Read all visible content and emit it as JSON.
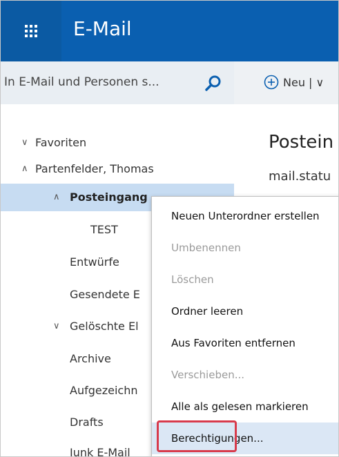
{
  "app": {
    "title": "E-Mail"
  },
  "search": {
    "placeholder": "In E-Mail und Personen s..."
  },
  "command_bar": {
    "new_label": "Neu | ∨"
  },
  "tree": [
    {
      "label": "Favoriten",
      "chevron": "∨"
    },
    {
      "label": "Partenfelder, Thomas",
      "chevron": "∧"
    },
    {
      "label": "Posteingang",
      "chevron": "∧",
      "selected": true
    },
    {
      "label": "TEST"
    },
    {
      "label": "Entwürfe"
    },
    {
      "label": "Gesendete E"
    },
    {
      "label": "Gelöschte El",
      "chevron": "∨"
    },
    {
      "label": "Archive"
    },
    {
      "label": "Aufgezeichn"
    },
    {
      "label": "Drafts"
    },
    {
      "label": "Junk E-Mail"
    }
  ],
  "main": {
    "folder_title": "Postein",
    "status_text": "mail.statu"
  },
  "context_menu": [
    {
      "label": "Neuen Unterordner erstellen",
      "enabled": true
    },
    {
      "label": "Umbenennen",
      "enabled": false
    },
    {
      "label": "Löschen",
      "enabled": false
    },
    {
      "label": "Ordner leeren",
      "enabled": true
    },
    {
      "label": "Aus Favoriten entfernen",
      "enabled": true
    },
    {
      "label": "Verschieben...",
      "enabled": false
    },
    {
      "label": "Alle als gelesen markieren",
      "enabled": true
    },
    {
      "label": "Berechtigungen...",
      "enabled": true,
      "highlighted": true
    }
  ],
  "colors": {
    "topbar": "#0a5fb0",
    "selection": "#c7dcf2",
    "highlight_border": "#d83b4c"
  }
}
